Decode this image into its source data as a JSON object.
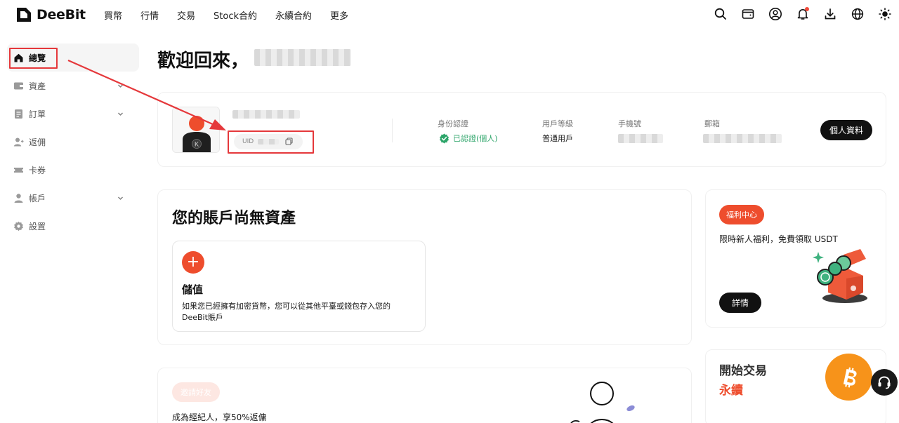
{
  "header": {
    "logo_text": "DeeBit",
    "nav": [
      "買幣",
      "行情",
      "交易",
      "Stock合約",
      "永續合約",
      "更多"
    ],
    "icons": [
      "search-icon",
      "wallet-icon",
      "user-icon",
      "bell-icon",
      "download-icon",
      "globe-icon",
      "sun-icon"
    ]
  },
  "sidebar": {
    "items": [
      {
        "label": "總覽",
        "icon": "home-icon",
        "active": true
      },
      {
        "label": "資產",
        "icon": "wallet-icon",
        "expandable": true
      },
      {
        "label": "訂單",
        "icon": "order-icon",
        "expandable": true
      },
      {
        "label": "返佣",
        "icon": "referral-icon"
      },
      {
        "label": "卡券",
        "icon": "ticket-icon"
      },
      {
        "label": "帳戶",
        "icon": "account-icon",
        "expandable": true
      },
      {
        "label": "設置",
        "icon": "settings-icon"
      }
    ]
  },
  "main": {
    "welcome": "歡迎回來，",
    "profile": {
      "uid_label": "UID",
      "kyc_label": "身份認證",
      "kyc_value": "已認證(個人)",
      "level_label": "用戶等級",
      "level_value": "普通用戶",
      "phone_label": "手機號",
      "email_label": "郵箱",
      "profile_button": "個人資料",
      "avatar_letter": "K"
    },
    "assets": {
      "title": "您的賬戶尚無資產",
      "deposit_title": "儲值",
      "deposit_desc": "如果您已經擁有加密貨幣，您可以從其他平臺或錢包存入您的DeeBit賬戶"
    },
    "invite": {
      "tag": "邀請好友",
      "text": "成為經紀人，享50%返傭"
    },
    "welfare": {
      "tag": "福利中心",
      "text": "限時新人福利，免費領取 USDT",
      "button": "詳情"
    },
    "trade": {
      "title": "開始交易",
      "subtitle": "永續"
    }
  },
  "colors": {
    "accent": "#ee4d2d",
    "annotation": "#e5383b",
    "verified": "#2ea56a",
    "bitcoin": "#f7931a"
  }
}
